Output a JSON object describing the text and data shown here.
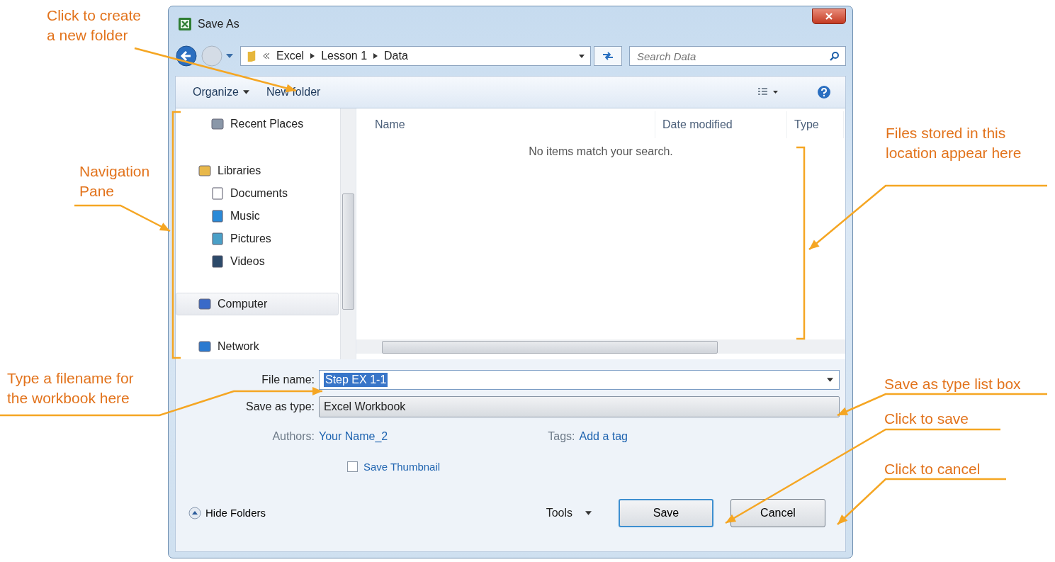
{
  "window": {
    "title": "Save As"
  },
  "address": {
    "crumbs": [
      "Excel",
      "Lesson 1",
      "Data"
    ]
  },
  "search": {
    "placeholder": "Search Data"
  },
  "toolbar": {
    "organize": "Organize",
    "new_folder": "New folder"
  },
  "nav": [
    {
      "label": "Recent Places",
      "selected": false
    },
    {
      "label": "Libraries",
      "selected": false,
      "children": [
        {
          "label": "Documents",
          "selected": false
        },
        {
          "label": "Music",
          "selected": false
        },
        {
          "label": "Pictures",
          "selected": false
        },
        {
          "label": "Videos",
          "selected": false
        }
      ]
    },
    {
      "label": "Computer",
      "selected": true
    },
    {
      "label": "Network",
      "selected": false
    }
  ],
  "columns": [
    "Name",
    "Date modified",
    "Type"
  ],
  "empty_message": "No items match your search.",
  "file_name": {
    "label": "File name:",
    "value": "Step EX 1-1"
  },
  "save_type": {
    "label": "Save as type:",
    "value": "Excel Workbook"
  },
  "authors": {
    "label": "Authors:",
    "value": "Your Name_2"
  },
  "tags": {
    "label": "Tags:",
    "value": "Add a tag"
  },
  "thumbnail": {
    "label": "Save Thumbnail",
    "checked": false
  },
  "hide_folders": "Hide Folders",
  "tools": "Tools",
  "buttons": [
    {
      "label": "Save",
      "default": true
    },
    {
      "label": "Cancel",
      "default": false
    }
  ],
  "annotations": [
    "Click to create\na new folder",
    "Navigation\nPane",
    "Type a filename for\nthe workbook here",
    "Files stored in this\nlocation appear here",
    "Save as type list box",
    "Click to save",
    "Click to cancel"
  ]
}
